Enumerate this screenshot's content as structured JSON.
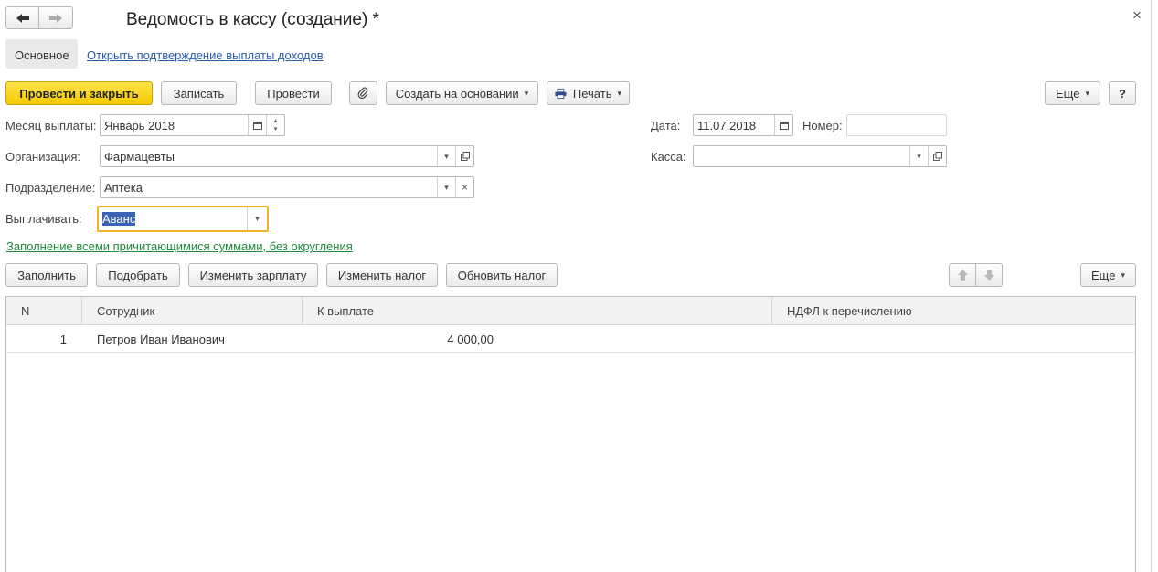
{
  "header": {
    "title": "Ведомость в кассу (создание) *",
    "close_glyph": "×"
  },
  "nav": {
    "main_tab": "Основное",
    "link": "Открыть подтверждение выплаты доходов"
  },
  "toolbar": {
    "post_close": "Провести и закрыть",
    "save": "Записать",
    "post": "Провести",
    "create_based": "Создать на основании",
    "print": "Печать",
    "more": "Еще",
    "help": "?"
  },
  "form": {
    "month_label": "Месяц выплаты:",
    "month_value": "Январь 2018",
    "org_label": "Организация:",
    "org_value": "Фармацевты",
    "dept_label": "Подразделение:",
    "dept_value": "Аптека",
    "pay_label": "Выплачивать:",
    "pay_value": "Аванс",
    "date_label": "Дата:",
    "date_value": "11.07.2018",
    "number_label": "Номер:",
    "number_value": "",
    "cash_label": "Касса:",
    "cash_value": "",
    "fill_link": "Заполнение всеми причитающимися суммами, без округления"
  },
  "table_toolbar": {
    "fill": "Заполнить",
    "pick": "Подобрать",
    "change_salary": "Изменить зарплату",
    "change_tax": "Изменить налог",
    "update_tax": "Обновить налог",
    "more": "Еще"
  },
  "table": {
    "columns": [
      "N",
      "Сотрудник",
      "К выплате",
      "НДФЛ к перечислению"
    ],
    "rows": [
      {
        "n": "1",
        "employee": "Петров Иван  Иванович",
        "amount": "4 000,00",
        "tax": ""
      }
    ]
  },
  "colors": {
    "accent_yellow": "#f4c900",
    "link_blue": "#2a5caa",
    "link_green": "#1e8a3c",
    "focus_orange": "#f0b429"
  }
}
